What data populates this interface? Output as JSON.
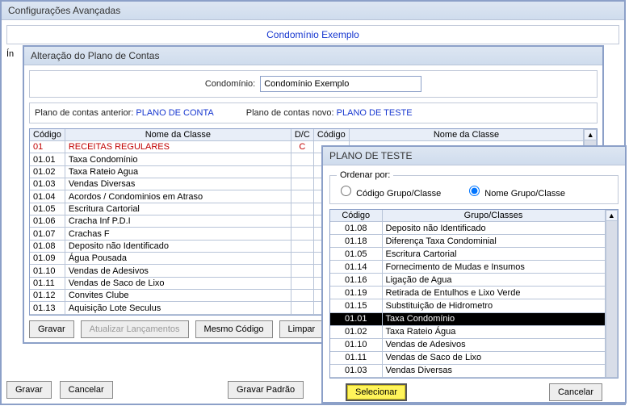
{
  "main": {
    "title": "Configurações Avançadas",
    "condominio": "Condomínio Exemplo",
    "indice_label": "Ín",
    "buttons": {
      "gravar": "Gravar",
      "cancelar": "Cancelar",
      "gravar_padrao": "Gravar Padrão"
    }
  },
  "alteracao": {
    "title": "Alteração do Plano de Contas",
    "condominio_label": "Condomínio:",
    "condominio_value": "Condomínio Exemplo",
    "plano_anterior_label": "Plano de contas anterior:",
    "plano_anterior_value": "PLANO DE CONTA",
    "plano_novo_label": "Plano de contas novo:",
    "plano_novo_value": "PLANO DE TESTE",
    "headers": {
      "codigo": "Código",
      "nome": "Nome da Classe",
      "dc": "D/C",
      "codigo2": "Código",
      "nome2": "Nome da Classe"
    },
    "rows": [
      {
        "codigo": "01",
        "nome": "RECEITAS REGULARES",
        "dc": "C",
        "red": true
      },
      {
        "codigo": "01.01",
        "nome": "Taxa Condomínio",
        "dc": ""
      },
      {
        "codigo": "01.02",
        "nome": "Taxa Rateio Agua",
        "dc": ""
      },
      {
        "codigo": "01.03",
        "nome": "Vendas Diversas",
        "dc": ""
      },
      {
        "codigo": "01.04",
        "nome": "Acordos / Condominios em Atraso",
        "dc": ""
      },
      {
        "codigo": "01.05",
        "nome": "Escritura Cartorial",
        "dc": ""
      },
      {
        "codigo": "01.06",
        "nome": "Cracha Inf P.D.I",
        "dc": ""
      },
      {
        "codigo": "01.07",
        "nome": "Crachas F",
        "dc": ""
      },
      {
        "codigo": "01.08",
        "nome": "Deposito não Identificado",
        "dc": ""
      },
      {
        "codigo": "01.09",
        "nome": "Água Pousada",
        "dc": ""
      },
      {
        "codigo": "01.10",
        "nome": "Vendas de Adesivos",
        "dc": ""
      },
      {
        "codigo": "01.11",
        "nome": "Vendas de Saco de Lixo",
        "dc": ""
      },
      {
        "codigo": "01.12",
        "nome": "Convites Clube",
        "dc": ""
      },
      {
        "codigo": "01.13",
        "nome": "Aquisição Lote Seculus",
        "dc": ""
      }
    ],
    "buttons": {
      "gravar": "Gravar",
      "atualizar": "Atualizar Lançamentos",
      "mesmo": "Mesmo Código",
      "limpar": "Limpar"
    }
  },
  "plano_teste": {
    "title": "PLANO DE TESTE",
    "ordenar_label": "Ordenar por:",
    "radio_codigo": "Código Grupo/Classe",
    "radio_nome": "Nome Grupo/Classe",
    "headers": {
      "codigo": "Código",
      "grupo": "Grupo/Classes"
    },
    "selected_index": 7,
    "rows": [
      {
        "codigo": "01.08",
        "grupo": "Deposito não Identificado"
      },
      {
        "codigo": "01.18",
        "grupo": "Diferença Taxa Condominial"
      },
      {
        "codigo": "01.05",
        "grupo": "Escritura Cartorial"
      },
      {
        "codigo": "01.14",
        "grupo": "Fornecimento de Mudas e Insumos"
      },
      {
        "codigo": "01.16",
        "grupo": "Ligação de Agua"
      },
      {
        "codigo": "01.19",
        "grupo": "Retirada de Entulhos e Lixo Verde"
      },
      {
        "codigo": "01.15",
        "grupo": "Substituição de Hidrometro"
      },
      {
        "codigo": "01.01",
        "grupo": "Taxa Condomínio"
      },
      {
        "codigo": "01.02",
        "grupo": "Taxa Rateio Água"
      },
      {
        "codigo": "01.10",
        "grupo": "Vendas de Adesivos"
      },
      {
        "codigo": "01.11",
        "grupo": "Vendas de Saco de Lixo"
      },
      {
        "codigo": "01.03",
        "grupo": "Vendas Diversas"
      }
    ],
    "buttons": {
      "selecionar": "Selecionar",
      "cancelar": "Cancelar"
    }
  }
}
